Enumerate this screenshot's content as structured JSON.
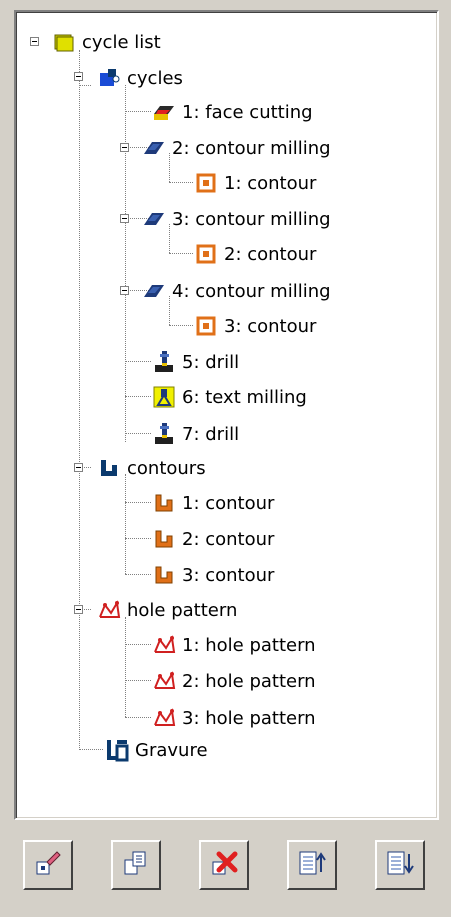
{
  "tree": {
    "root": {
      "label": "cycle list",
      "icon": "folder-icon"
    },
    "cycles": {
      "label": "cycles",
      "icon": "cycles-icon",
      "items": [
        {
          "label": "1: face cutting",
          "icon": "face-cutting-icon"
        },
        {
          "label": "2: contour milling",
          "icon": "contour-milling-icon",
          "child": "1: contour"
        },
        {
          "label": "3: contour milling",
          "icon": "contour-milling-icon",
          "child": "2: contour"
        },
        {
          "label": "4: contour milling",
          "icon": "contour-milling-icon",
          "child": "3: contour"
        },
        {
          "label": "5: drill",
          "icon": "drill-icon"
        },
        {
          "label": "6: text milling",
          "icon": "text-milling-icon"
        },
        {
          "label": "7: drill",
          "icon": "drill-icon"
        }
      ]
    },
    "contours": {
      "label": "contours",
      "icon": "contours-icon",
      "items": [
        "1: contour",
        "2: contour",
        "3: contour"
      ]
    },
    "hole_pattern": {
      "label": "hole pattern",
      "icon": "hole-pattern-icon",
      "items": [
        "1: hole pattern",
        "2: hole pattern",
        "3: hole pattern"
      ]
    },
    "gravure": {
      "label": "Gravure",
      "icon": "gravure-icon"
    }
  },
  "toolbar": {
    "buttons": [
      {
        "name": "edit-button",
        "icon": "edit-icon"
      },
      {
        "name": "copy-button",
        "icon": "copy-icon"
      },
      {
        "name": "delete-button",
        "icon": "delete-icon"
      },
      {
        "name": "move-up-button",
        "icon": "move-up-icon"
      },
      {
        "name": "move-down-button",
        "icon": "move-down-icon"
      }
    ]
  },
  "colors": {
    "window_bg": "#d4d0c8",
    "tree_bg": "#ffffff",
    "contour_orange": "#e07018",
    "cycle_blue": "#0b3a6e",
    "folder_yellow": "#c8c800"
  }
}
